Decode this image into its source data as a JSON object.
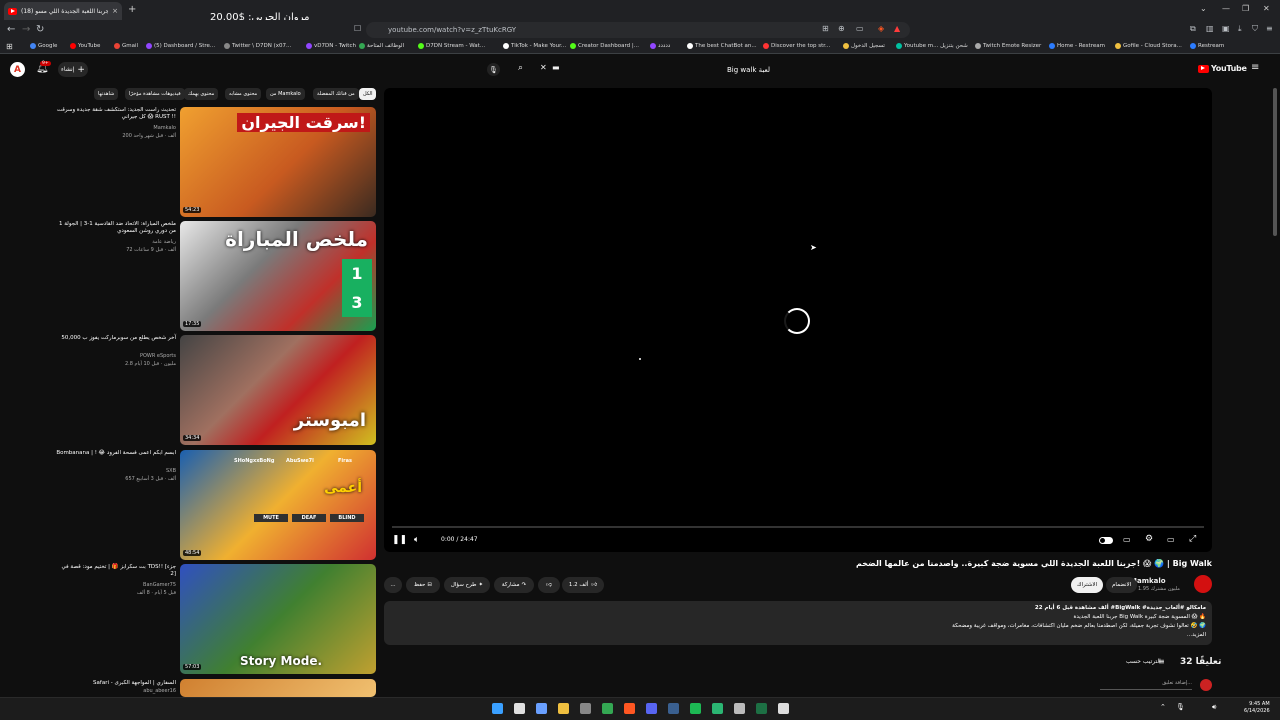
{
  "browser": {
    "tab_title": "(18) جربنا اللعبة الجديدة اللي مسو",
    "tab_close": "×",
    "new_tab": "+",
    "url": "youtube.com/watch?v=z_zTtuKcRGY",
    "overlay_text": "مروان الحربي: $20.00",
    "bookmarks": [
      {
        "label": "Google",
        "color": "#4285f4"
      },
      {
        "label": "YouTube",
        "color": "#ff0000"
      },
      {
        "label": "Gmail",
        "color": "#ea4335"
      },
      {
        "label": "(5) Dashboard / Stre...",
        "color": "#9146ff"
      },
      {
        "label": "Twitter \\ D7DN (x07...",
        "color": "#888888"
      },
      {
        "label": "vD7DN - Twitch",
        "color": "#9146ff"
      },
      {
        "label": "الوظائف المتاحة",
        "color": "#34a853"
      },
      {
        "label": "D7DN Stream - Wat...",
        "color": "#53fc18"
      },
      {
        "label": "TikTok - Make Your...",
        "color": "#ffffff"
      },
      {
        "label": "Creator Dashboard |...",
        "color": "#53fc18"
      },
      {
        "label": "ددددد",
        "color": "#9146ff"
      },
      {
        "label": "The best ChatBot an...",
        "color": "#ffffff"
      },
      {
        "label": "Discover the top str...",
        "color": "#ff3333"
      },
      {
        "label": "تسجيل الدخول",
        "color": "#f0c040"
      },
      {
        "label": "Youtube m... شحن بتنزيل",
        "color": "#00c0a0"
      },
      {
        "label": "Twitch Emote Resizer",
        "color": "#aaaaaa"
      },
      {
        "label": "Home - Restream",
        "color": "#2b7cff"
      },
      {
        "label": "Gofile - Cloud Stora...",
        "color": "#f0c040"
      },
      {
        "label": "Restream",
        "color": "#2b7cff"
      }
    ]
  },
  "header": {
    "logo": "YouTube",
    "search_query": "Big walk لعبة",
    "create_label": "إنشاء",
    "notification_count": "9+"
  },
  "chips": [
    "الكل",
    "من قناتك المفضلة",
    "من Mamkalo",
    "محتوى مشابه",
    "محتوى يهمك",
    "فيديوهات مشاهدة مؤخرًا",
    "شاهدتها"
  ],
  "player": {
    "time": "0:00 / 24:47"
  },
  "video": {
    "title": "جربنا اللعبة الجديدة اللي مسوية ضجة كبيرة.. واصدمنا من عالمها الضخم! 😱 🌍 | Big Walk",
    "channel": "Mamkalo",
    "subscribers": "1.95 مليون مشترك",
    "join_label": "الانضمام",
    "subscribe_label": "الاشتراك",
    "likes": "1.2 ألف",
    "share_label": "مشاركة",
    "remix_label": "طرح سؤال",
    "save_label": "حفظ",
    "more_label": "...",
    "desc_meta": "22 ألف مشاهدة قبل 6 أيام #BigWalk #مامكالو #ألعاب_جديدة",
    "desc_line1": "جربنا اللعبة الجديدة Big Walk المسوية ضجة كبيرة 😱 🔥",
    "desc_line2": "تعالوا نشوف تجربة جميلة، لكن اصطدمنا بعالم ضخم مليان اكتشافات، مغامرات، ومواقف غريبة ومضحكة 🤣 🌍",
    "desc_more": "...المزيد",
    "comments_count": "32 تعليقًا",
    "sort_label": "الترتيب حسب",
    "add_comment": "إضافة تعليق..."
  },
  "recommendations": [
    {
      "title": "تحديث راست الجديد: استكشف شقة جديدة وسرقت كل جيراني 😱 RUST !!",
      "channel": "Mamkalo",
      "meta": "200 ألف · قبل شهر واحد",
      "duration": "54:23",
      "thumb_text": "سرقت الجيران!"
    },
    {
      "title": "ملخص المباراة: الاتحاد ضد القادسية 1-3 | الجولة 1 من دوري روشن السعودي",
      "channel": "رياضة عامة",
      "meta": "72 ألف · قبل 9 ساعات",
      "duration": "17:35",
      "thumb_text": "ملخص المباراة",
      "score_home": "1",
      "score_away": "3"
    },
    {
      "title": "آخر شخص يطلع من سوبرماركت يفوز ب 50,000",
      "channel": "POWR eSports",
      "meta": "2.8 مليون · قبل 10 أيام",
      "duration": "34:34",
      "thumb_text": "امبوستر"
    },
    {
      "title": "Bombanana | ! 😂 ابسم ابكم اعمى فسحة الفرود",
      "channel": "SXB",
      "meta": "657 ألف · قبل 3 أسابيع",
      "duration": "48:54",
      "thumb_text": "أعمى",
      "labels": [
        "SHoNgxxBoNg",
        "AbuSwe7l",
        "Firas"
      ],
      "chips": [
        "MUTE",
        "DEAF",
        "BLIND"
      ]
    },
    {
      "title": "بت سكرابز 🎁 | تختيم مود: قصة في TDS!! [جزء 2]",
      "channel": "BanGamer75",
      "meta": "قبل 5 أيام · 8 ألف",
      "duration": "57:03",
      "thumb_text": "Story Mode."
    },
    {
      "title": "Safari - السفاري | المواجهة الكبرى",
      "channel": "abu_abeer16",
      "meta": "",
      "duration": "",
      "thumb_text": ""
    }
  ],
  "taskbar": {
    "time": "9:45 AM",
    "date": "6/14/2026"
  },
  "colors": {
    "accent": "#ff0000",
    "background": "#0f0f0f",
    "chip": "#272727"
  }
}
